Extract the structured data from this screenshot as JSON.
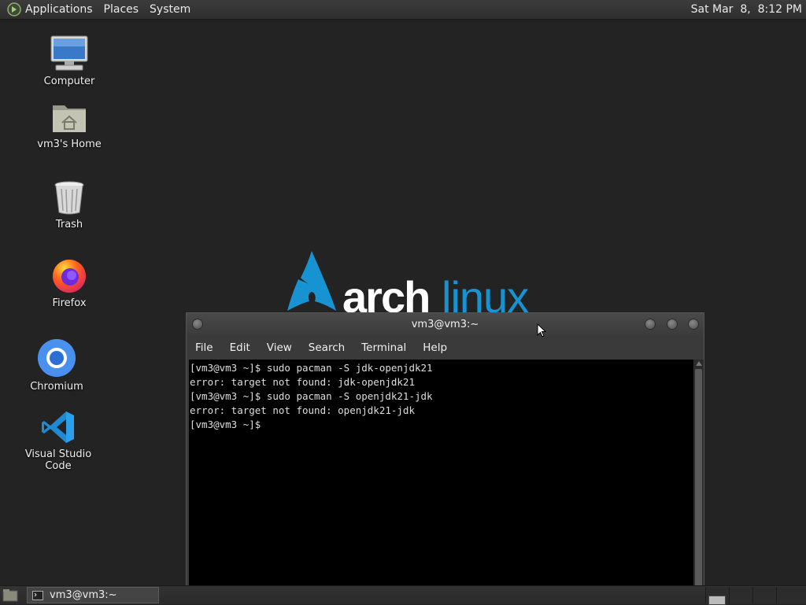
{
  "top_panel": {
    "menus": [
      "Applications",
      "Places",
      "System"
    ],
    "clock": "Sat Mar  8,  8:12 PM"
  },
  "desktop": {
    "icons": [
      {
        "label": "Computer",
        "icon": "computer-icon"
      },
      {
        "label": "vm3's Home",
        "icon": "home-folder-icon"
      },
      {
        "label": "Trash",
        "icon": "trash-icon"
      },
      {
        "label": "Firefox",
        "icon": "firefox-icon"
      },
      {
        "label": "Chromium",
        "icon": "chromium-icon"
      },
      {
        "label": "Visual Studio Code",
        "icon": "vscode-icon"
      }
    ],
    "wallpaper_text": {
      "arch": "arch",
      "linux": "linux"
    }
  },
  "terminal": {
    "title": "vm3@vm3:~",
    "menu": [
      "File",
      "Edit",
      "View",
      "Search",
      "Terminal",
      "Help"
    ],
    "lines": [
      "[vm3@vm3 ~]$ sudo pacman -S jdk-openjdk21",
      "error: target not found: jdk-openjdk21",
      "[vm3@vm3 ~]$ sudo pacman -S openjdk21-jdk",
      "error: target not found: openjdk21-jdk",
      "[vm3@vm3 ~]$ "
    ]
  },
  "bottom_panel": {
    "task_label": "vm3@vm3:~"
  },
  "colors": {
    "desktop_bg": "#232323",
    "arch_blue": "#1793d1",
    "terminal_bg": "#000000"
  }
}
